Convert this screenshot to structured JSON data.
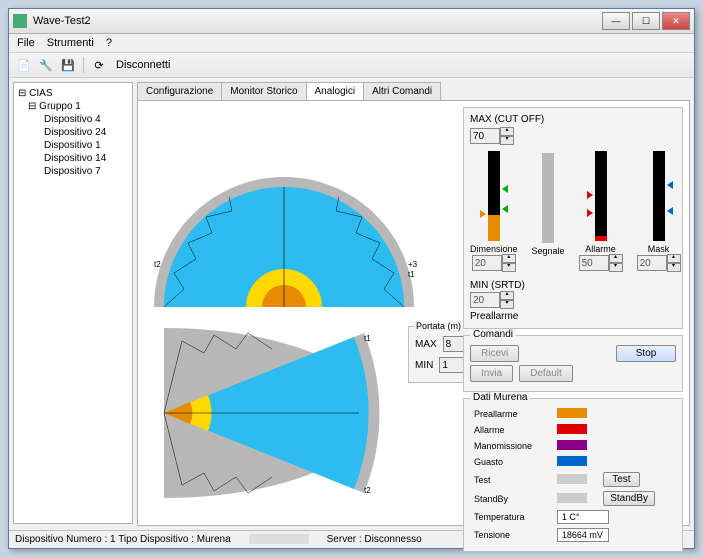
{
  "window": {
    "title": "Wave-Test2"
  },
  "menu": {
    "file": "File",
    "strumenti": "Strumenti",
    "help": "?"
  },
  "toolbar": {
    "disconnect": "Disconnetti"
  },
  "tree": {
    "root": "CIAS",
    "group": "Gruppo 1",
    "devices": [
      "Dispositivo 4",
      "Dispositivo 24",
      "Dispositivo 1",
      "Dispositivo 14",
      "Dispositivo 7"
    ]
  },
  "tabs": {
    "config": "Configurazione",
    "monitor": "Monitor Storico",
    "analog": "Analogici",
    "altri": "Altri Comandi"
  },
  "portata": {
    "legend": "Portata (m)",
    "max_label": "MAX",
    "min_label": "MIN",
    "max": "8",
    "min": "1"
  },
  "cutoff": {
    "max_label": "MAX (CUT OFF)",
    "max_value": "70",
    "bars": {
      "dim": "Dimensione",
      "seg": "Segnale",
      "all": "Allarme",
      "mask": "Mask"
    },
    "dim_value": "20",
    "all_value": "50",
    "mask_value": "20",
    "min_label": "MIN (SRTD)",
    "min_value": "20",
    "preallarme": "Preallarme"
  },
  "comandi": {
    "legend": "Comandi",
    "ricevi": "Ricevi",
    "invia": "Invia",
    "default": "Default",
    "stop": "Stop"
  },
  "dati": {
    "legend": "Dati Murena",
    "preallarme": "Preallarme",
    "allarme": "Allarme",
    "manomissione": "Manomissione",
    "guasto": "Guasto",
    "test": "Test",
    "standby": "StandBy",
    "btn_test": "Test",
    "btn_standby": "StandBy",
    "temp_label": "Temperatura",
    "temp_value": "1 C°",
    "tens_label": "Tensione",
    "tens_value": "18664 mV"
  },
  "status": {
    "device": "Dispositivo Numero : 1  Tipo Dispositivo : Murena",
    "server": "Server : Disconnesso"
  }
}
